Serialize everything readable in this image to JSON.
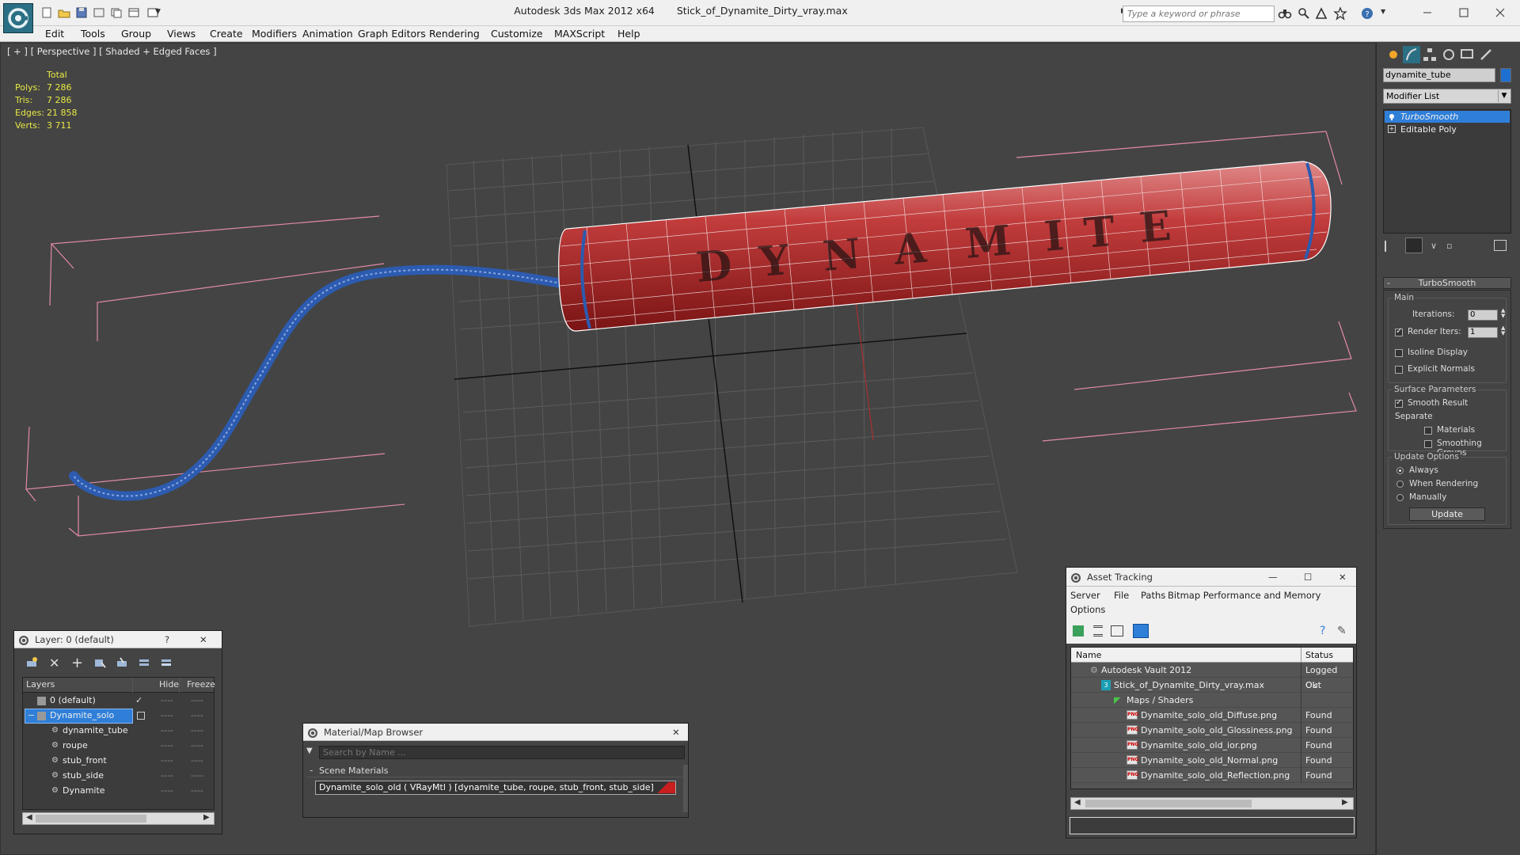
{
  "app": {
    "title": "Autodesk 3ds Max  2012 x64",
    "file": "Stick_of_Dynamite_Dirty_vray.max"
  },
  "search": {
    "placeholder": "Type a keyword or phrase"
  },
  "menu": [
    "Edit",
    "Tools",
    "Group",
    "Views",
    "Create",
    "Modifiers",
    "Animation",
    "Graph Editors",
    "Rendering",
    "Customize",
    "MAXScript",
    "Help"
  ],
  "viewport": {
    "label": "[ + ] [ Perspective ] [ Shaded + Edged Faces ]",
    "stats": {
      "header": "Total",
      "rows": [
        {
          "label": "Polys:",
          "value": "7 286"
        },
        {
          "label": "Tris:",
          "value": "7 286"
        },
        {
          "label": "Edges:",
          "value": "21 858"
        },
        {
          "label": "Verts:",
          "value": "3 711"
        }
      ]
    }
  },
  "command_panel": {
    "object_name": "dynamite_tube",
    "object_color": "#1f6fd0",
    "modifier_list": "Modifier List",
    "stack": [
      "TurboSmooth",
      "Editable Poly"
    ],
    "rollout_title": "TurboSmooth",
    "main_group": "Main",
    "iterations_label": "Iterations:",
    "iterations_value": "0",
    "render_iters_label": "Render Iters:",
    "render_iters_value": "1",
    "isoline_label": "Isoline Display",
    "explicit_normals_label": "Explicit Normals",
    "surface_group": "Surface Parameters",
    "smooth_result_label": "Smooth Result",
    "separate_label": "Separate",
    "materials_label": "Materials",
    "smoothing_groups_label": "Smoothing Groups",
    "update_group": "Update Options",
    "update_options": [
      "Always",
      "When Rendering",
      "Manually"
    ],
    "update_button": "Update"
  },
  "layer_window": {
    "title": "Layer: 0 (default)",
    "help": "?",
    "columns": {
      "layers": "Layers",
      "hide": "Hide",
      "freeze": "Freeze"
    },
    "rows": [
      {
        "name": "0 (default)",
        "indent": 1
      },
      {
        "name": "Dynamite_solo",
        "indent": 1
      },
      {
        "name": "dynamite_tube",
        "indent": 2
      },
      {
        "name": "roupe",
        "indent": 2
      },
      {
        "name": "stub_front",
        "indent": 2
      },
      {
        "name": "stub_side",
        "indent": 2
      },
      {
        "name": "Dynamite",
        "indent": 2
      }
    ]
  },
  "material_browser": {
    "title": "Material/Map Browser",
    "search_placeholder": "Search by Name ...",
    "group": "Scene Materials",
    "item": "Dynamite_solo_old  ( VRayMtl ) [dynamite_tube, roupe, stub_front, stub_side]"
  },
  "asset_tracking": {
    "title": "Asset Tracking",
    "menu": [
      "Server",
      "File",
      "Paths",
      "Bitmap Performance and Memory",
      "Options"
    ],
    "columns": {
      "name": "Name",
      "status": "Status"
    },
    "rows": [
      {
        "name": "Autodesk Vault 2012",
        "status": "Logged Out",
        "indent": 1,
        "icon": "vault"
      },
      {
        "name": "Stick_of_Dynamite_Dirty_vray.max",
        "status": "Ok",
        "indent": 2,
        "icon": "max"
      },
      {
        "name": "Maps / Shaders",
        "status": "",
        "indent": 3,
        "icon": "folder"
      },
      {
        "name": "Dynamite_solo_old_Diffuse.png",
        "status": "Found",
        "indent": 4,
        "icon": "png"
      },
      {
        "name": "Dynamite_solo_old_Glossiness.png",
        "status": "Found",
        "indent": 4,
        "icon": "png"
      },
      {
        "name": "Dynamite_solo_old_ior.png",
        "status": "Found",
        "indent": 4,
        "icon": "png"
      },
      {
        "name": "Dynamite_solo_old_Normal.png",
        "status": "Found",
        "indent": 4,
        "icon": "png"
      },
      {
        "name": "Dynamite_solo_old_Reflection.png",
        "status": "Found",
        "indent": 4,
        "icon": "png"
      }
    ]
  }
}
